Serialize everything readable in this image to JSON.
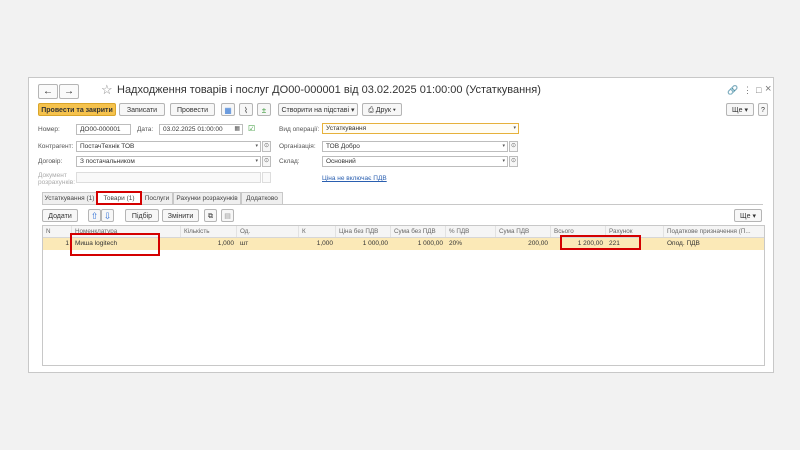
{
  "window": {
    "title": "Надходження товарів і послуг ДО00-000001 від 03.02.2025 01:00:00 (Устаткування)",
    "back_icon": "←",
    "forward_icon": "→",
    "star_icon": "☆",
    "link_icon": "🔗",
    "more_icon": "⋮",
    "maximize_icon": "□",
    "close_icon": "×"
  },
  "toolbar": {
    "post_close": "Провести та закрити",
    "save": "Записати",
    "post": "Провести",
    "create_based": "Створити на підставі",
    "print": "Друк",
    "more": "Ще",
    "help": "?"
  },
  "form": {
    "number_label": "Номер:",
    "number_value": "ДО00-000001",
    "date_label": "Дата:",
    "date_value": "03.02.2025 01:00:00",
    "op_type_label": "Вид операції:",
    "op_type_value": "Устаткування",
    "contractor_label": "Контрагент:",
    "contractor_value": "ПостачТехнік ТОВ",
    "organization_label": "Організація:",
    "organization_value": "ТОВ Добро",
    "contract_label": "Договір:",
    "contract_value": "З постачальником",
    "warehouse_label": "Склад:",
    "warehouse_value": "Основний",
    "settlement_doc_label_1": "Документ",
    "settlement_doc_label_2": "розрахунків:",
    "vat_link": "Ціна не включає ПДВ"
  },
  "tabs": [
    {
      "label": "Устаткування (1)"
    },
    {
      "label": "Товари (1)"
    },
    {
      "label": "Послуги"
    },
    {
      "label": "Рахунки розрахунків"
    },
    {
      "label": "Додатково"
    }
  ],
  "table_toolbar": {
    "add": "Додати",
    "up_icon": "⇧",
    "down_icon": "⇩",
    "pick": "Підбір",
    "change": "Змінити",
    "more": "Ще"
  },
  "table": {
    "columns": [
      "N",
      "Номенклатура",
      "Кількість",
      "Од.",
      "К",
      "Ціна без ПДВ",
      "Сума без ПДВ",
      "% ПДВ",
      "Сума ПДВ",
      "Всього",
      "Рахунок",
      "Податкове призначення (П..."
    ],
    "rows": [
      [
        "1",
        "Миша logitech",
        "1,000",
        "шт",
        "1,000",
        "1 000,00",
        "1 000,00",
        "20%",
        "200,00",
        "1 200,00",
        "221",
        "Опод. ПДВ"
      ]
    ]
  },
  "colors": {
    "accent": "#f5c24d",
    "selected_row": "#fbe9b7",
    "highlight_box": "#d40000",
    "link": "#2a5fb0"
  }
}
